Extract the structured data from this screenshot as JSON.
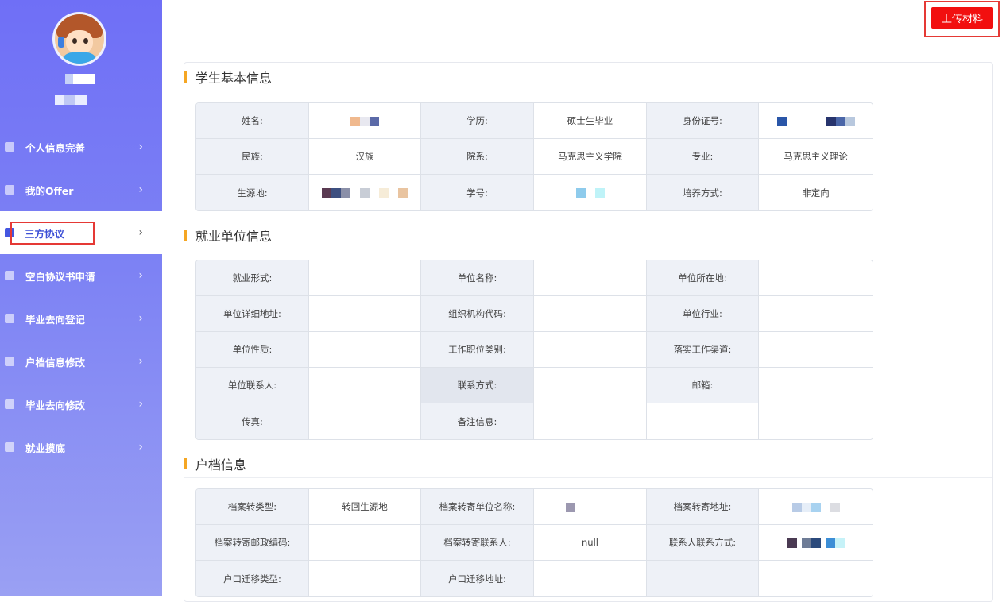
{
  "header": {
    "upload_label": "上传材料"
  },
  "sidebar": {
    "items": [
      {
        "label": "个人信息完善",
        "icon": "user-icon"
      },
      {
        "label": "我的Offer",
        "icon": "document-icon"
      },
      {
        "label": "三方协议",
        "icon": "document-icon",
        "active": true
      },
      {
        "label": "空白协议书申请",
        "icon": "grid-icon"
      },
      {
        "label": "毕业去向登记",
        "icon": "grid-icon"
      },
      {
        "label": "户档信息修改",
        "icon": "cloud-icon"
      },
      {
        "label": "毕业去向修改",
        "icon": "cloud-icon"
      },
      {
        "label": "就业摸底",
        "icon": "document-icon"
      }
    ]
  },
  "sections": {
    "student": {
      "title": "学生基本信息",
      "rows": [
        [
          "姓名:",
          "",
          "学历:",
          "硕士生毕业",
          "身份证号:",
          ""
        ],
        [
          "民族:",
          "汉族",
          "院系:",
          "马克思主义学院",
          "专业:",
          "马克思主义理论"
        ],
        [
          "生源地:",
          "",
          "学号:",
          "",
          "培养方式:",
          "非定向"
        ]
      ]
    },
    "employer": {
      "title": "就业单位信息",
      "rows": [
        [
          "就业形式:",
          "",
          "单位名称:",
          "",
          "单位所在地:",
          ""
        ],
        [
          "单位详细地址:",
          "",
          "组织机构代码:",
          "",
          "单位行业:",
          ""
        ],
        [
          "单位性质:",
          "",
          "工作职位类别:",
          "",
          "落实工作渠道:",
          ""
        ],
        [
          "单位联系人:",
          "",
          "联系方式:",
          "",
          "邮箱:",
          ""
        ],
        [
          "传真:",
          "",
          "备注信息:",
          "",
          "",
          ""
        ]
      ]
    },
    "archive": {
      "title": "户档信息",
      "rows": [
        [
          "档案转类型:",
          "转回生源地",
          "档案转寄单位名称:",
          "",
          "档案转寄地址:",
          ""
        ],
        [
          "档案转寄邮政编码:",
          "",
          "档案转寄联系人:",
          "null",
          "联系人联系方式:",
          ""
        ],
        [
          "户口迁移类型:",
          "",
          "户口迁移地址:",
          "",
          "",
          ""
        ]
      ]
    }
  },
  "colors": {
    "accent": "#f20f0f",
    "sidebar_top": "#6f6ff6",
    "active_text": "#3c4fd6",
    "title_bar": "#f5a623"
  }
}
